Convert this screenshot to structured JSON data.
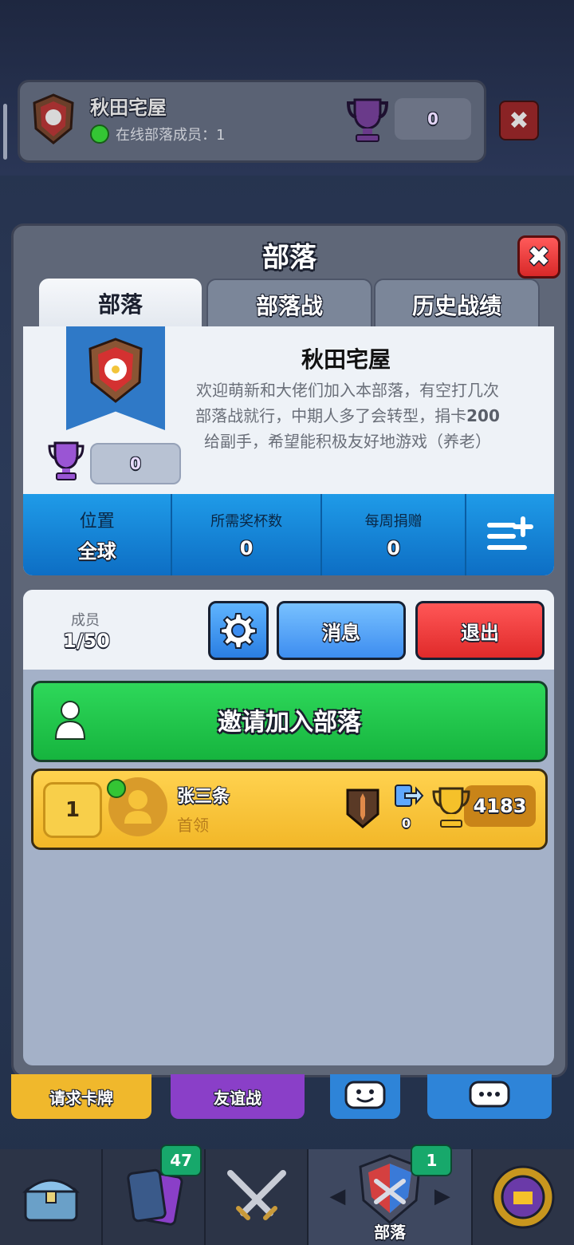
{
  "background_header": {
    "clan_name": "秋田宅屋",
    "online_label": "在线部落成员：1",
    "trophies": "0"
  },
  "modal": {
    "title": "部落",
    "close_label": "✖",
    "tabs": [
      {
        "label": "部落"
      },
      {
        "label": "部落战"
      },
      {
        "label": "历史战绩"
      }
    ],
    "clan": {
      "name": "秋田宅屋",
      "description_1": "欢迎萌新和大佬们加入本部落，有空打几次部落战就行，中期人多了会转型，捐卡",
      "description_bold": "200",
      "description_2": "给副手，希望能积极友好地游戏（养老）",
      "trophies": "0"
    },
    "stats": {
      "location_label": "位置",
      "location_value": "全球",
      "required_trophies_label": "所需奖杯数",
      "required_trophies_value": "0",
      "weekly_donations_label": "每周捐赠",
      "weekly_donations_value": "0"
    },
    "members": {
      "label": "成员",
      "count": "1/50",
      "message_button": "消息",
      "exit_button": "退出",
      "invite_button": "邀请加入部落",
      "list": [
        {
          "rank": "1",
          "name": "张三条",
          "role": "首领",
          "donations": "0",
          "trophies": "4183"
        }
      ]
    }
  },
  "bottom_buttons": {
    "request_cards": "请求卡牌",
    "friendly_battle": "友谊战"
  },
  "nav": {
    "cards_badge": "47",
    "clan_badge": "1",
    "clan_label": "部落"
  },
  "colors": {
    "tab_active": "#eef2f7",
    "stats_blue": "#1f9be8",
    "invite_green": "#2ed85a",
    "exit_red": "#e02a2a",
    "member_gold": "#ffd24f"
  }
}
